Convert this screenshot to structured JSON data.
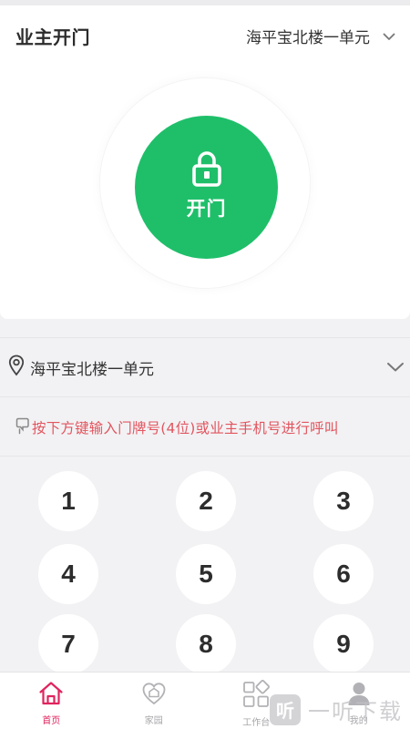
{
  "header": {
    "title": "业主开门",
    "building_selector": "海平宝北楼一单元"
  },
  "door": {
    "button_label": "开门"
  },
  "location": {
    "text": "海平宝北楼一单元"
  },
  "hint": {
    "text": "按下方键输入门牌号(4位)或业主手机号进行呼叫"
  },
  "keypad": {
    "keys": [
      "1",
      "2",
      "3",
      "4",
      "5",
      "6",
      "7",
      "8",
      "9"
    ]
  },
  "tabbar": {
    "tabs": [
      {
        "label": "首页",
        "icon": "home-icon",
        "active": true
      },
      {
        "label": "家园",
        "icon": "community-icon",
        "active": false
      },
      {
        "label": "工作台",
        "icon": "workbench-icon",
        "active": false
      },
      {
        "label": "我的",
        "icon": "profile-icon",
        "active": false
      }
    ]
  },
  "watermark": {
    "glyph": "听",
    "text": "一听下载"
  },
  "colors": {
    "accent_green": "#1fbf6a",
    "hint_red": "#e2555f",
    "tab_active": "#e0245e",
    "background": "#f2f2f4"
  }
}
